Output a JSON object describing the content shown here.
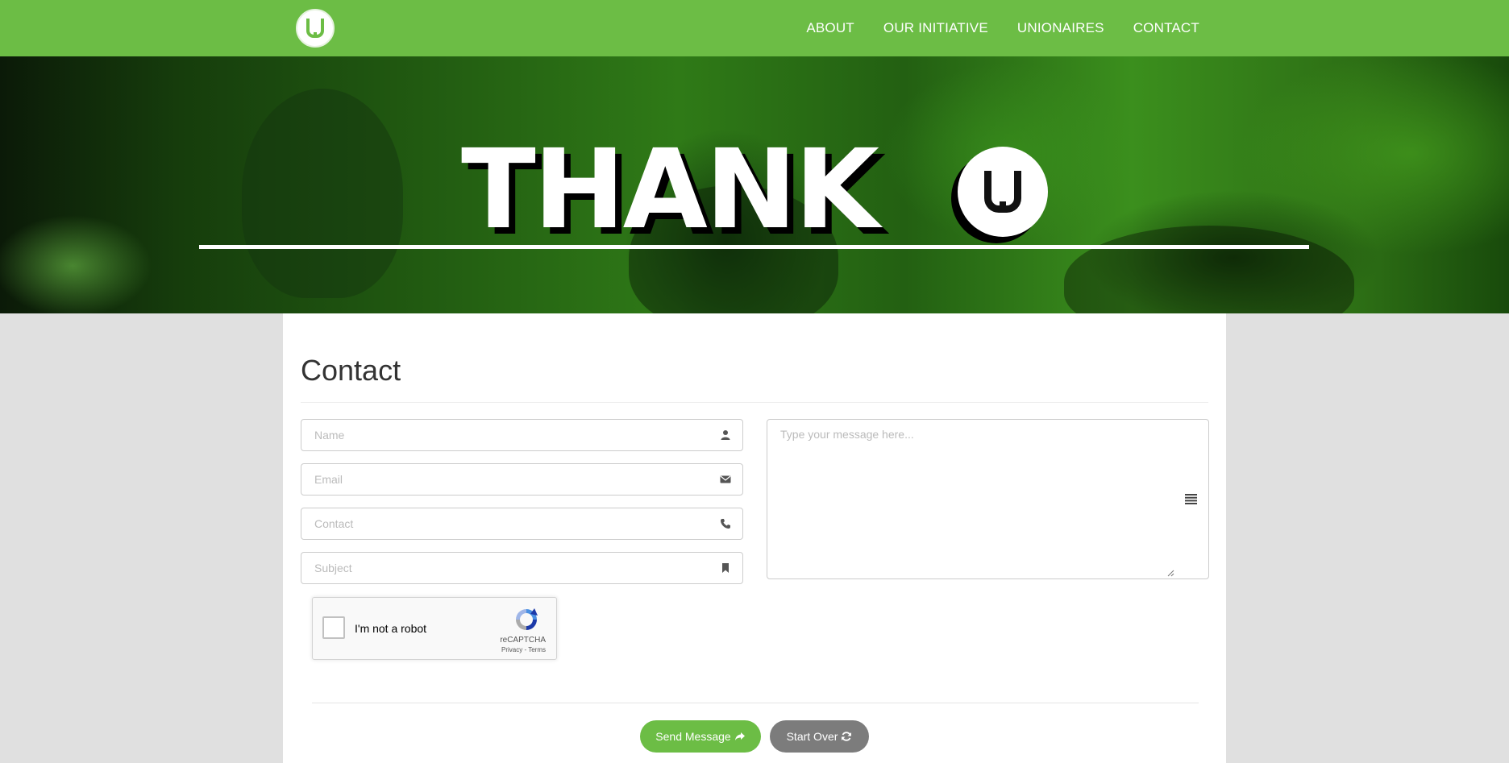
{
  "nav": {
    "logo_alt": "U",
    "links": [
      {
        "label": "ABOUT"
      },
      {
        "label": "OUR INITIATIVE"
      },
      {
        "label": "UNIONAIRES"
      },
      {
        "label": "CONTACT"
      }
    ]
  },
  "hero": {
    "title": "THANK",
    "title_badge": "U"
  },
  "form": {
    "heading": "Contact",
    "name_placeholder": "Name",
    "email_placeholder": "Email",
    "contact_placeholder": "Contact",
    "subject_placeholder": "Subject",
    "message_placeholder": "Type your message here...",
    "captcha": {
      "label": "I'm not a robot",
      "brand": "reCAPTCHA",
      "links": "Privacy - Terms"
    },
    "send_label": "Send Message",
    "reset_label": "Start Over"
  },
  "icons": {
    "name_field": "user-icon",
    "email_field": "envelope-icon",
    "contact_field": "phone-icon",
    "subject_field": "bookmark-icon",
    "message_field": "lines-icon",
    "send": "share-arrow-icon",
    "reset": "refresh-icon"
  },
  "colors": {
    "brand_green": "#6cbd45",
    "reset_gray": "#7c7c7c",
    "page_bg": "#e0e0e0"
  }
}
